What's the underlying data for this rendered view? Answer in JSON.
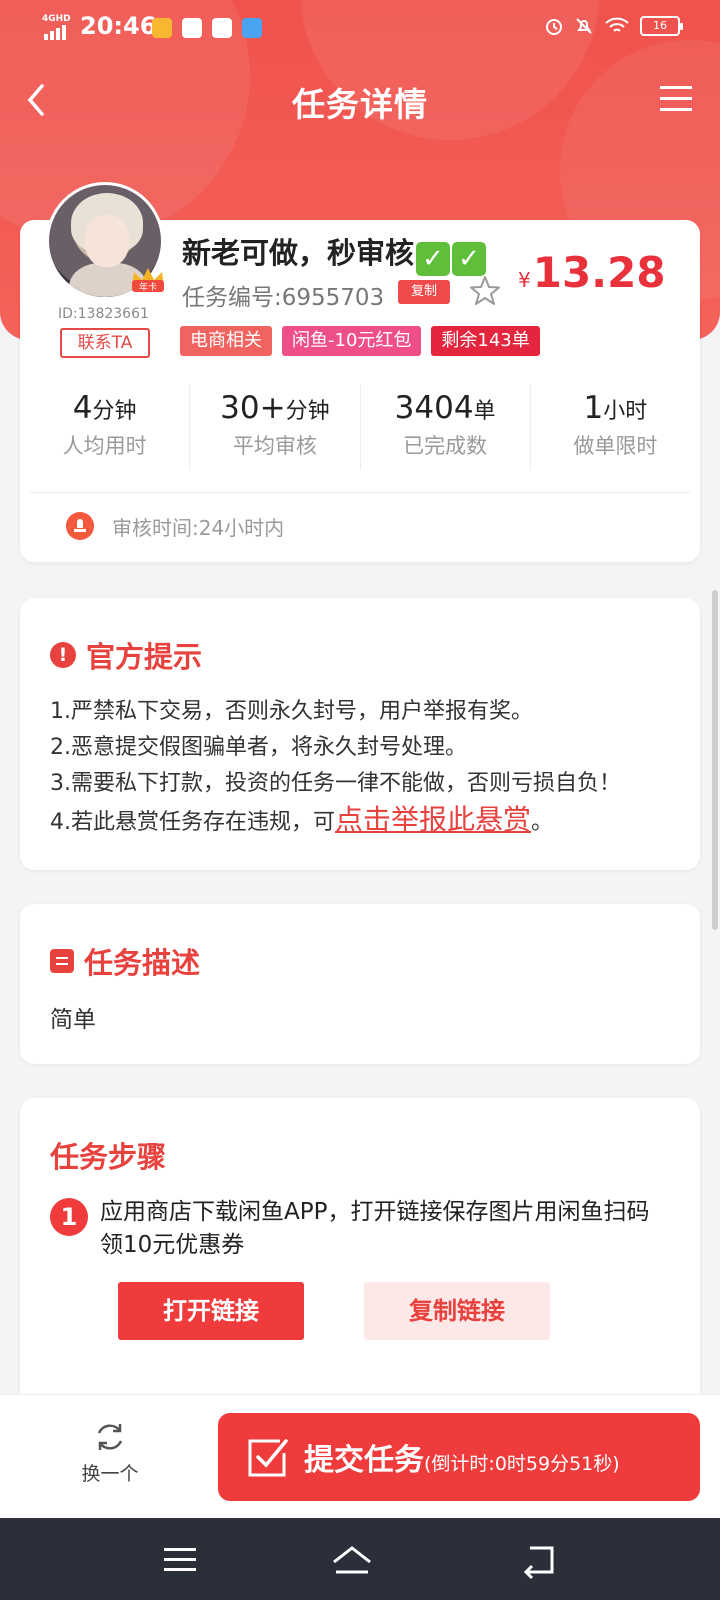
{
  "status_bar": {
    "network": "4GHD",
    "time": "20:46",
    "battery": "16"
  },
  "header": {
    "title": "任务详情"
  },
  "publisher": {
    "id": "ID:13823661",
    "contact_label": "联系TA",
    "badge": "年卡"
  },
  "task": {
    "title": "新老可做，秒审核",
    "checks": [
      "✓",
      "✓"
    ],
    "number": "任务编号:6955703",
    "copy_label": "复制",
    "price_symbol": "¥",
    "price": "13.28",
    "tags": [
      {
        "label": "电商相关",
        "color": "#f1635e"
      },
      {
        "label": "闲鱼-10元红包",
        "color": "#ef4f88"
      },
      {
        "label": "剩余143单",
        "color": "#e3263e"
      }
    ]
  },
  "stats": [
    {
      "value": "4",
      "unit": "分钟",
      "label": "人均用时"
    },
    {
      "value": "30+",
      "unit": "分钟",
      "label": "平均审核"
    },
    {
      "value": "3404",
      "unit": "单",
      "label": "已完成数"
    },
    {
      "value": "1",
      "unit": "小时",
      "label": "做单限时"
    }
  ],
  "audit_time": "审核时间:24小时内",
  "official_tips": {
    "title": "官方提示",
    "rules": [
      "1.严禁私下交易，否则永久封号，用户举报有奖。",
      "2.恶意提交假图骗单者，将永久封号处理。",
      "3.需要私下打款，投资的任务一律不能做，否则亏损自负！"
    ],
    "rule4_prefix": "4.若此悬赏任务存在违规，可",
    "report_link": "点击举报此悬赏",
    "rule4_suffix": "。"
  },
  "description": {
    "title": "任务描述",
    "text": "简单"
  },
  "steps": {
    "title": "任务步骤",
    "items": [
      {
        "num": "1",
        "text": "应用商店下载闲鱼APP，打开链接保存图片用闲鱼扫码领10元优惠券",
        "open_label": "打开链接",
        "copy_label": "复制链接"
      }
    ]
  },
  "bottom": {
    "swap_label": "换一个",
    "submit_label": "提交任务",
    "countdown": "(倒计时:0时59分51秒)"
  },
  "colors": {
    "primary": "#ef3b3b",
    "hero": "#f0524d",
    "price": "#e8313b"
  }
}
